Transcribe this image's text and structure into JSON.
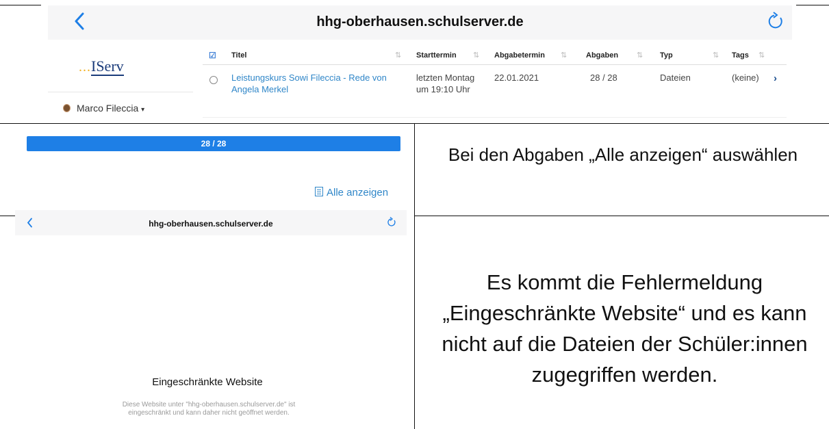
{
  "top_screenshot": {
    "browser_title": "hhg-oberhausen.schulserver.de",
    "logo_text": "IServ",
    "user_name": "Marco Fileccia",
    "table": {
      "columns": [
        "Titel",
        "Starttermin",
        "Abgabetermin",
        "Abgaben",
        "Typ",
        "Tags"
      ],
      "row": {
        "titel": "Leistungskurs Sowi Fileccia - Rede von Angela Merkel",
        "starttermin": "letzten Montag um 19:10 Uhr",
        "abgabetermin": "22.01.2021",
        "abgaben": "28 / 28",
        "typ": "Dateien",
        "tags": "(keine)"
      }
    }
  },
  "middle": {
    "progress_label": "28 / 28",
    "progress_fraction": 1.0,
    "show_all_link": "Alle anzeigen",
    "caption": "Bei den Abgaben „Alle anzeigen“ auswählen"
  },
  "bottom_screenshot": {
    "browser_title": "hhg-oberhausen.schulserver.de",
    "error_title": "Eingeschränkte Website",
    "error_description": "Diese Website unter \"hhg-oberhausen.schulserver.de\" ist eingeschränkt und kann daher nicht geöffnet werden.",
    "caption": "Es kommt die Fehlermeldung „Eingeschränkte Website“ und es kann nicht auf die Dateien der Schüler:innen zugegriffen werden."
  },
  "colors": {
    "accent_blue": "#2f86c8",
    "progress_blue": "#1e7fe6",
    "nav_bg": "#f6f6f7"
  }
}
